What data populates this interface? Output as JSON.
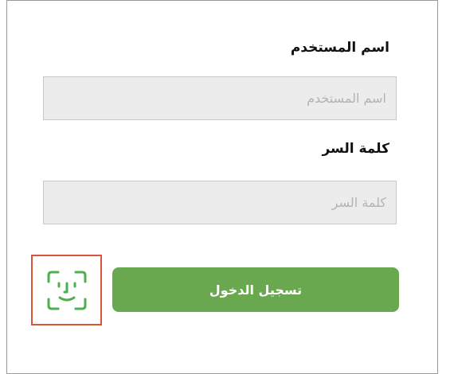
{
  "form": {
    "username_label": "اسم المستخدم",
    "username_placeholder": "اسم المستخدم",
    "username_value": "",
    "password_label": "كلمة السر",
    "password_placeholder": "كلمة السر",
    "password_value": "",
    "login_button": "تسجيل الدخول"
  },
  "icons": {
    "face_id": "face-id-icon"
  },
  "colors": {
    "accent_green": "#6aa84f",
    "faceid_green": "#4caf50",
    "highlight_border": "#d9553a",
    "field_bg": "#ececec"
  }
}
